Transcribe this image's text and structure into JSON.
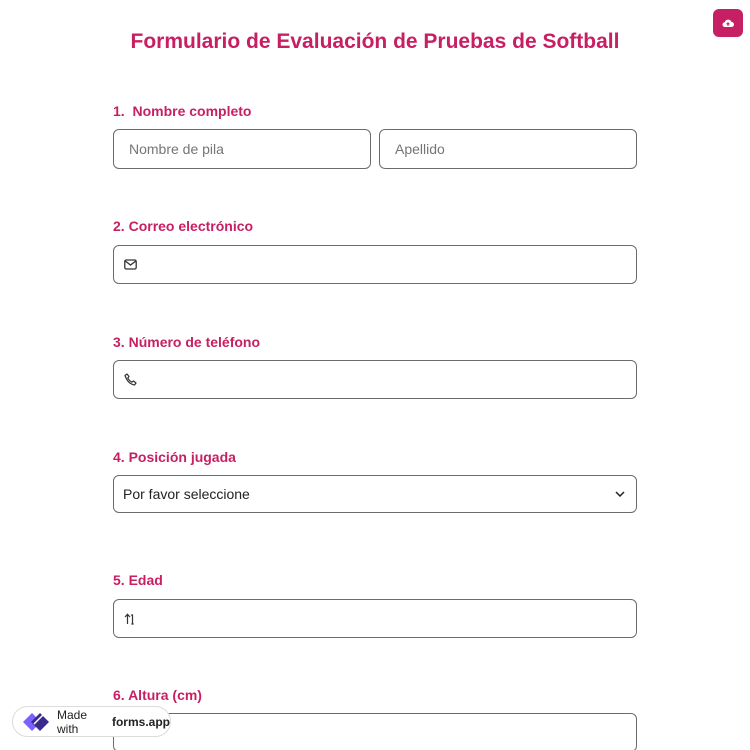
{
  "form": {
    "title": "Formulario de Evaluación de Pruebas de Softball",
    "questions": [
      {
        "number": "1.",
        "label": "Nombre completo",
        "first_placeholder": "Nombre de pila",
        "last_placeholder": "Apellido"
      },
      {
        "number": "2.",
        "label": "Correo electrónico",
        "icon": "mail-icon"
      },
      {
        "number": "3.",
        "label": "Número de teléfono",
        "icon": "phone-icon"
      },
      {
        "number": "4.",
        "label": "Posición jugada",
        "selected": "Por favor seleccione",
        "icon": "chevron-down-icon"
      },
      {
        "number": "5.",
        "label": "Edad",
        "icon": "number-sort-icon"
      },
      {
        "number": "6.",
        "label": "Altura (cm)"
      }
    ]
  },
  "badge": {
    "prefix": "Made with",
    "brand": "forms.app"
  },
  "colors": {
    "accent": "#c71f63",
    "border": "#6b6b6b"
  }
}
